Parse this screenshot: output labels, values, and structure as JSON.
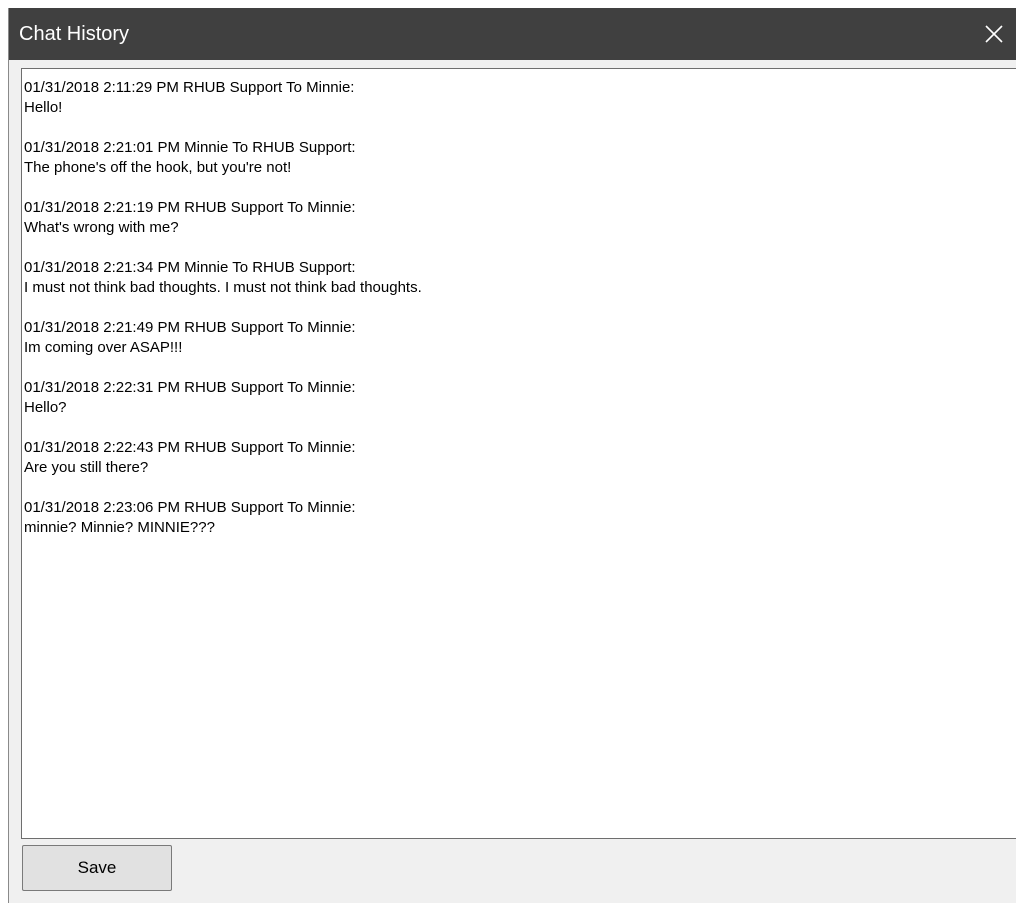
{
  "window": {
    "title": "Chat History",
    "close_icon": "close-icon"
  },
  "chat": {
    "messages": [
      {
        "header": "01/31/2018 2:11:29 PM RHUB Support To Minnie:",
        "text": "Hello!"
      },
      {
        "header": "01/31/2018 2:21:01 PM Minnie To RHUB Support:",
        "text": "The phone's off the hook, but you're not!"
      },
      {
        "header": "01/31/2018 2:21:19 PM RHUB Support To Minnie:",
        "text": "What's wrong with me?"
      },
      {
        "header": "01/31/2018 2:21:34 PM Minnie To RHUB Support:",
        "text": "I must not think bad thoughts. I must not think bad thoughts."
      },
      {
        "header": "01/31/2018 2:21:49 PM RHUB Support To Minnie:",
        "text": "Im coming over ASAP!!!"
      },
      {
        "header": "01/31/2018 2:22:31 PM RHUB Support To Minnie:",
        "text": "Hello?"
      },
      {
        "header": "01/31/2018 2:22:43 PM RHUB Support To Minnie:",
        "text": "Are you still there?"
      },
      {
        "header": "01/31/2018 2:23:06 PM RHUB Support To Minnie:",
        "text": "minnie? Minnie? MINNIE???"
      }
    ]
  },
  "footer": {
    "save_label": "Save"
  },
  "colors": {
    "titlebar": "#404040",
    "window_bg": "#f0f0f0",
    "button_bg": "#e1e1e1"
  }
}
